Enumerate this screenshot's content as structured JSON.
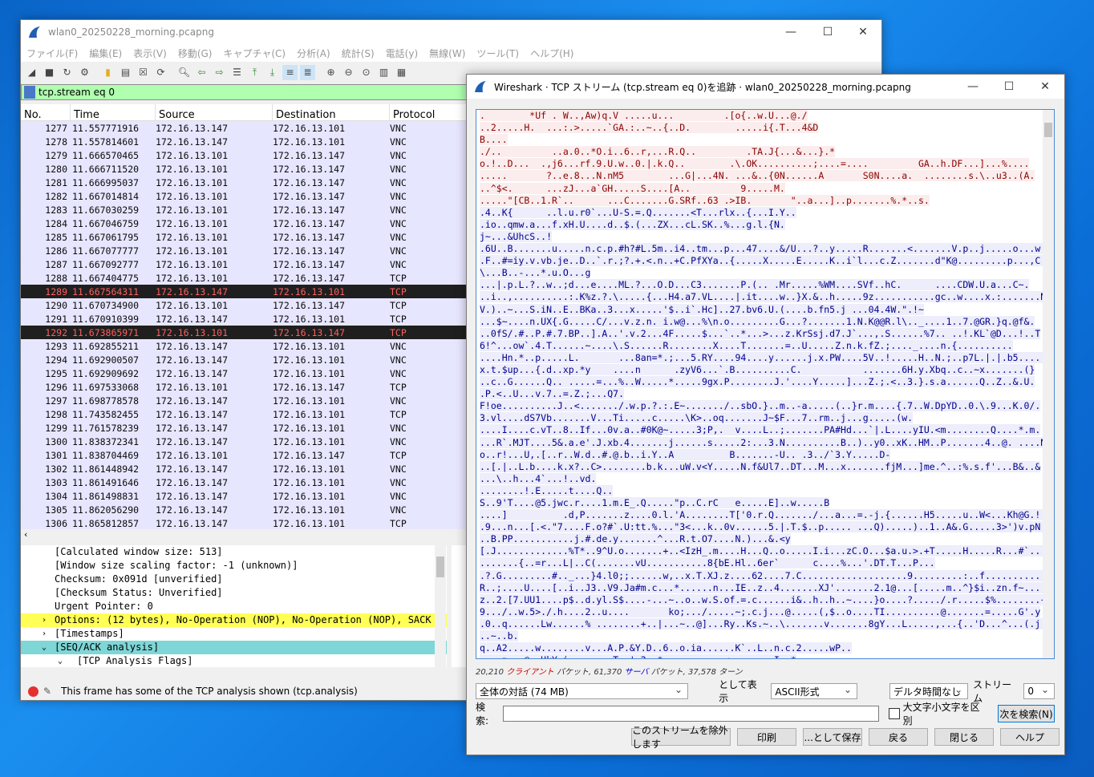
{
  "main": {
    "title": "wlan0_20250228_morning.pcapng",
    "menu": [
      "ファイル(F)",
      "編集(E)",
      "表示(V)",
      "移動(G)",
      "キャプチャ(C)",
      "分析(A)",
      "統計(S)",
      "電話(y)",
      "無線(W)",
      "ツール(T)",
      "ヘルプ(H)"
    ],
    "filter": "tcp.stream eq 0",
    "columns": [
      "No.",
      "Time",
      "Source",
      "Destination",
      "Protocol"
    ],
    "packets": [
      [
        "1277",
        "11.557771916",
        "172.16.13.147",
        "172.16.13.101",
        "VNC"
      ],
      [
        "1278",
        "11.557814601",
        "172.16.13.147",
        "172.16.13.101",
        "VNC"
      ],
      [
        "1279",
        "11.666570465",
        "172.16.13.101",
        "172.16.13.147",
        "VNC"
      ],
      [
        "1280",
        "11.666711520",
        "172.16.13.101",
        "172.16.13.147",
        "VNC"
      ],
      [
        "1281",
        "11.666995037",
        "172.16.13.101",
        "172.16.13.147",
        "VNC"
      ],
      [
        "1282",
        "11.667014814",
        "172.16.13.101",
        "172.16.13.147",
        "VNC"
      ],
      [
        "1283",
        "11.667030259",
        "172.16.13.101",
        "172.16.13.147",
        "VNC"
      ],
      [
        "1284",
        "11.667046759",
        "172.16.13.101",
        "172.16.13.147",
        "VNC"
      ],
      [
        "1285",
        "11.667061795",
        "172.16.13.101",
        "172.16.13.147",
        "VNC"
      ],
      [
        "1286",
        "11.667077777",
        "172.16.13.101",
        "172.16.13.147",
        "VNC"
      ],
      [
        "1287",
        "11.667092777",
        "172.16.13.101",
        "172.16.13.147",
        "VNC"
      ],
      [
        "1288",
        "11.667404775",
        "172.16.13.101",
        "172.16.13.147",
        "TCP"
      ],
      [
        "1289",
        "11.667564311",
        "172.16.13.147",
        "172.16.13.101",
        "TCP"
      ],
      [
        "1290",
        "11.670734900",
        "172.16.13.101",
        "172.16.13.147",
        "TCP"
      ],
      [
        "1291",
        "11.670910399",
        "172.16.13.147",
        "172.16.13.101",
        "TCP"
      ],
      [
        "1292",
        "11.673865971",
        "172.16.13.101",
        "172.16.13.147",
        "TCP"
      ],
      [
        "1293",
        "11.692855211",
        "172.16.13.147",
        "172.16.13.101",
        "VNC"
      ],
      [
        "1294",
        "11.692900507",
        "172.16.13.147",
        "172.16.13.101",
        "VNC"
      ],
      [
        "1295",
        "11.692909692",
        "172.16.13.147",
        "172.16.13.101",
        "VNC"
      ],
      [
        "1296",
        "11.697533068",
        "172.16.13.101",
        "172.16.13.147",
        "TCP"
      ],
      [
        "1297",
        "11.698778578",
        "172.16.13.147",
        "172.16.13.101",
        "VNC"
      ],
      [
        "1298",
        "11.743582455",
        "172.16.13.147",
        "172.16.13.101",
        "TCP"
      ],
      [
        "1299",
        "11.761578239",
        "172.16.13.147",
        "172.16.13.101",
        "VNC"
      ],
      [
        "1300",
        "11.838372341",
        "172.16.13.147",
        "172.16.13.101",
        "VNC"
      ],
      [
        "1301",
        "11.838704469",
        "172.16.13.101",
        "172.16.13.147",
        "TCP"
      ],
      [
        "1302",
        "11.861448942",
        "172.16.13.147",
        "172.16.13.101",
        "VNC"
      ],
      [
        "1303",
        "11.861491646",
        "172.16.13.147",
        "172.16.13.101",
        "VNC"
      ],
      [
        "1304",
        "11.861498831",
        "172.16.13.147",
        "172.16.13.101",
        "VNC"
      ],
      [
        "1305",
        "11.862056290",
        "172.16.13.147",
        "172.16.13.101",
        "VNC"
      ],
      [
        "1306",
        "11.865812857",
        "172.16.13.147",
        "172.16.13.101",
        "TCP"
      ]
    ],
    "selected_rows": [
      "1289",
      "1292"
    ],
    "details": [
      {
        "text": "[Calculated window size: 513]",
        "style": "",
        "arrow": ""
      },
      {
        "text": "[Window size scaling factor: -1 (unknown)]",
        "style": "",
        "arrow": ""
      },
      {
        "text": "Checksum: 0x091d [unverified]",
        "style": "",
        "arrow": ""
      },
      {
        "text": "[Checksum Status: Unverified]",
        "style": "",
        "arrow": ""
      },
      {
        "text": "Urgent Pointer: 0",
        "style": "",
        "arrow": ""
      },
      {
        "text": "Options: (12 bytes), No-Operation (NOP), No-Operation (NOP), SACK",
        "style": "yel",
        "arrow": "›"
      },
      {
        "text": "[Timestamps]",
        "style": "",
        "arrow": "›"
      },
      {
        "text": "[SEQ/ACK analysis]",
        "style": "cyan",
        "arrow": "⌄"
      },
      {
        "text": "[TCP Analysis Flags]",
        "style": "sub",
        "arrow": "⌄"
      }
    ],
    "status_text": "This frame has some of the TCP analysis shown (tcp.analysis)"
  },
  "dialog": {
    "title": "Wireshark · TCP ストリーム (tcp.stream eq 0)を追跡 · wlan0_20250228_morning.pcapng",
    "stream_lines": [
      {
        "dir": "c",
        "text": ".        *Uf . W..,Aw)q.V .....u...         .[o{..w.U...@./"
      },
      {
        "dir": "c",
        "text": "..2.....H.  ...:.>.....`GA.:..~..{..D.        .....i{.T...4&D"
      },
      {
        "dir": "c",
        "text": "B...."
      },
      {
        "dir": "c",
        "text": "./..         ..a.0..*O.i..6..r,...R.Q..         .TA.J{...&...}.*"
      },
      {
        "dir": "c",
        "text": "o.!..D...  .,j6...rf.9.U.w..0.|.k.Q..        .\\.OK..........;....=....         GA..h.DF...]...%...."
      },
      {
        "dir": "c",
        "text": ".....       ?..e.8...N.nM5        ...G|...4N. ...&..{0N......A       S0N....a.  ........s.\\..u3..(A."
      },
      {
        "dir": "c",
        "text": "..^$<.      ...zJ...a`GH.....S....[A..         9.....M."
      },
      {
        "dir": "c",
        "text": ".....\"[CB..1.R`..      ...C.......G.SRf..63 .>IB.       \"..a...]..p.......%.*..s."
      },
      {
        "dir": "s",
        "text": ".4..K{      ..l.u.r0`...U-S.=.Q.......<T...rlx..{...I.Y.."
      },
      {
        "dir": "s",
        "text": ".io..qmw.a...f.xH.U....d..$.(...ZX...cL.SK..%...g.l.{N."
      },
      {
        "dir": "s",
        "text": "j~...&UhcS..!"
      },
      {
        "dir": "s",
        "text": ".6U..B.......u.....n.c.p.#h?#L.5m..i4..tm...p...47....&/U...?..y.....R.......<.......V.p..j.....o...w."
      },
      {
        "dir": "s",
        "text": ".F..#=iy.v.vb.je..D..`.r.;?.+.<.n..+C.PfXYa..{.....X.....E.....K..i`l...c.Z.......d\"K@.........p...,C."
      },
      {
        "dir": "s",
        "text": "\\...B..-...*.u.O...g"
      },
      {
        "dir": "s",
        "text": "...|.p.L.?..w..;d...e....ML.?...O.D...C3.......P.(.. .Mr.....%WM....SVf..hC.      ....CDW.U.a...C~."
      },
      {
        "dir": "s",
        "text": "..i..,..........:.K%z.?.\\.....{...H4.a7.VL....|.it....w..}X.&..h.....9z...........gc..w....x.:.......N."
      },
      {
        "dir": "s",
        "text": "V.)..~...S.iN..E..BKa..3...x.....'$..i`.Hc]..27.bv6.U.(....b.fn5.j ...04.4W.\".!~"
      },
      {
        "dir": "s",
        "text": "...$~....n.UX{.G.....C/...v.z.n. i.w@...%\\n.o.........G...?.......1.N.K@@R.l\\.._....1..7.@GR.}q.@f&."
      },
      {
        "dir": "s",
        "text": "..0fS/.#..P.#.7.BP..].A..'.v.2...4F.....$...`..*...>...z.KrSsj.d7.J`...,.S......%7.. ..!.KL`@D...!..T"
      },
      {
        "dir": "s",
        "text": "6!^...ow`.4.T......~....\\.S......R........X....T.......=..U.....Z.n.k.fZ.;...._....n.{.........."
      },
      {
        "dir": "s",
        "text": "....Hn.*..p.....L.       ...8an=*.;...5.RY....94....y......j.x.PW....5V..!.....H..N.;..p7L.|.|.b5.....!"
      },
      {
        "dir": "s",
        "text": "x.t.$up...{.d..xp.*y    ....n      .zyV6...`.B..........C.           .......6H.y.Xbq..c..~x.......(}"
      },
      {
        "dir": "s",
        "text": "..c..G......Q.. .....=...%..W.....*.....9gx.P........J.'....Y.....]...Z.;.<..3.}.s.a......Q..Z..&.U."
      },
      {
        "dir": "s",
        "text": ".P.<..U...v.7..=.Z.;...Q7."
      },
      {
        "dir": "s",
        "text": "F!oe..........J..<......./.w.p.?.:.E~......./..sbO.}..m..-a.....(..}r.m....{.7..W.DpYD..0.\\.9...K.0/."
      },
      {
        "dir": "s",
        "text": "3.vl....dS7Vb.......V...Ti.....c.....\\K>..oq.......J~$F...7..rm..j...g.....(w."
      },
      {
        "dir": "s",
        "text": "....I....c.vT..8..If...0v.a..#0K@~.....3;P,.  v....L..;.......PA#Hd...`|.L....yIU.<m........Q....*.m."
      },
      {
        "dir": "s",
        "text": "...R`.MJT....5&.a.e'.J.xb.4.......j......s.....2:...3.N..........B..)..y0..xK..HM..P.......4..@. ....N.k"
      },
      {
        "dir": "s",
        "text": "o..r!...U,.[..r..W.d..#.@.b..i.Y..A          B.......-U.. .3../`3.Y.....D-"
      },
      {
        "dir": "s",
        "text": "..[.|..L.b....k.x?..C>........b.k...uW.v<Y.....N.f&Ul7..DT...M...x.......fjM...]me.^..:%.s.f'...B&..&"
      },
      {
        "dir": "s",
        "text": "...\\..h...4`...!..vd."
      },
      {
        "dir": "s",
        "text": "........!.E.....t....Q.."
      },
      {
        "dir": "s",
        "text": "S..9'T....@5.jwc.r....1.m.E_.Q.....\"p..C.rC   e.....E]..w.....B"
      },
      {
        "dir": "s",
        "text": "....]          .d,P.......z....0.l.'A........T['0.r.Q......./...a...=.-j.{......H5.....u..W<...Kh@G.!..F."
      },
      {
        "dir": "s",
        "text": ".9...n...[.<.\"7....F.o?#`.U:tt.%...\"3<...k..0v......5.|.T.$..p..... ...Q).....)..1..A&.G.....3>')v.pN."
      },
      {
        "dir": "s",
        "text": "..B.PP...........j.#.de.y.......^...R.t.O7....N.)...&.<y"
      },
      {
        "dir": "s",
        "text": "[.J.............%T*..9^U.o.......+..<IzH_.m....H...Q..o.....I.i...zC.O...$a.u.>.+T.....H.....R...#`..."
      },
      {
        "dir": "s",
        "text": ".......{..=r...L|..C(.......vU...........8{bE.Hl..6er`      c....%...'.DT.T...P..."
      },
      {
        "dir": "s",
        "text": ".?.G.........#.._...}4.l0;;......w,..x.T.XJ.z....62....7.C...................9.........:..f.............C6..."
      },
      {
        "dir": "s",
        "text": "R..;....U....[..i..J3..V9.Ja#m.c...*......n...IE..z..4.......XJ'.......2.1@...[.....m..^}$i..zn.f~.....U."
      },
      {
        "dir": "s",
        "text": "z..2.[7.UU1....p$..d.yl.S$....-...~..o..w.S.of.=.c......i&..h..h..~....}o....?...../.r.....$%........{D"
      },
      {
        "dir": "s",
        "text": "9.../..w.5>./.h....2..u....       ko;.../.....~;.c.j...@.....(,$..o....TI..........@.......=.....G'.y"
      },
      {
        "dir": "s",
        "text": ".0..q......Lw......% ........+..|...~..@]...Ry..Ks.~..\\.......v.......8gY...L.....,...{..'D...^...(.j...."
      },
      {
        "dir": "s",
        "text": "..~..b."
      },
      {
        "dir": "s",
        "text": "q..A2.....w........v...A.P.&Y.D..6..o.ia......K`..L..n.c.2.....wP.."
      },
      {
        "dir": "s",
        "text": "....n...@..UkY.i........T..'.2..*...........<........I..*"
      }
    ],
    "info": {
      "prefix": "20,210",
      "client_label": "クライアント",
      "mid": "パケット, 61,370",
      "server_label": "サーバ",
      "suffix": "パケット, 37,578 ターン"
    },
    "conversation": "全体の対話 (74 MB)",
    "show_as_label": "として表示",
    "show_as": "ASCII形式",
    "delta": "デルタ時間なし",
    "stream_label": "ストリーム",
    "stream_value": "0",
    "search_label": "検索:",
    "case_label": "大文字小文字を区別",
    "find_next": "次を検索(N)",
    "buttons": [
      "このストリームを除外します",
      "印刷",
      "...として保存",
      "戻る",
      "閉じる",
      "ヘルプ"
    ]
  },
  "colors": {
    "accent": "#0078d7",
    "filter_bg": "#afffaf",
    "client_fg": "#8b0000",
    "server_fg": "#00008b"
  }
}
